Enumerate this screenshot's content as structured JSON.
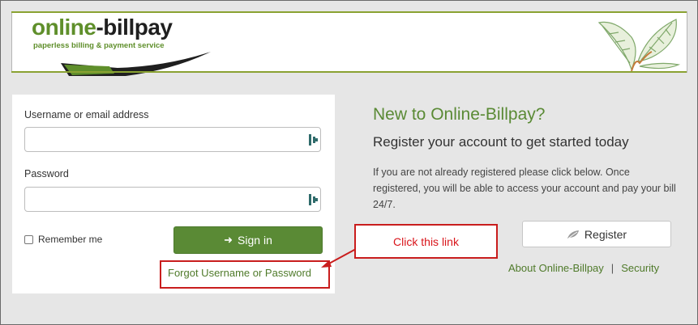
{
  "header": {
    "logo_main": "online",
    "logo_dash": "-billpay",
    "logo_tagline": "paperless billing & payment service"
  },
  "login": {
    "username_label": "Username or email address",
    "username_value": "",
    "password_label": "Password",
    "password_value": "",
    "remember_label": "Remember me",
    "signin_label": "Sign in",
    "forgot_link": "Forgot Username or Password"
  },
  "callout": {
    "text": "Click this link"
  },
  "register": {
    "title": "New to Online-Billpay?",
    "subtitle": "Register your account to get started today",
    "body": "If you are not already registered please click below. Once registered, you will be able to access your account and pay your bill 24/7.",
    "button_label": "Register"
  },
  "footer": {
    "about_link": "About Online-Billpay",
    "separator": "|",
    "security_link": "Security"
  },
  "colors": {
    "brand_green": "#5a8a35",
    "link_green": "#4f7a2a",
    "callout_red": "#c91d1d"
  }
}
